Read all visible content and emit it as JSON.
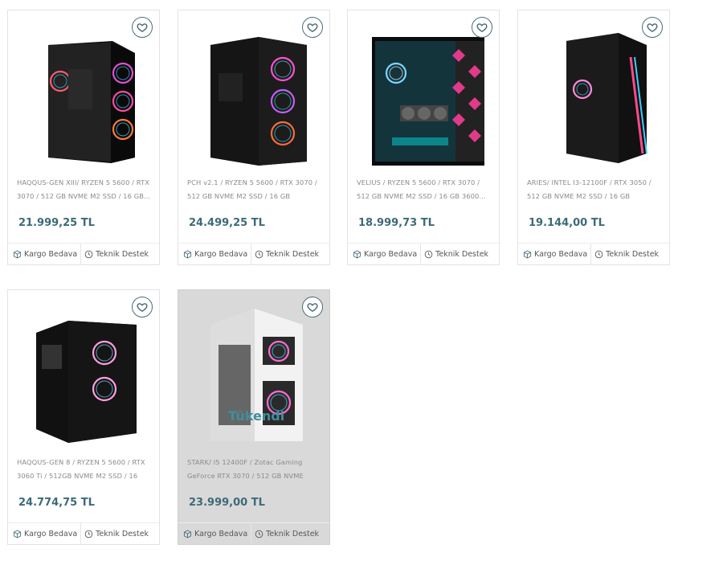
{
  "products": [
    {
      "title": "HAQQUS-GEN XIII/ RYZEN 5 5600 / RTX 3070 / 512 GB NVME M2 SSD / 16 GB...",
      "price": "21.999,25 TL",
      "badge1": "Kargo Bedava",
      "badge2": "Teknik Destek"
    },
    {
      "title": "PCH v2.1 / RYZEN 5 5600 / RTX 3070 / 512 GB NVME M2 SSD / 16 GB 3200MH...",
      "price": "24.499,25 TL",
      "badge1": "Kargo Bedava",
      "badge2": "Teknik Destek"
    },
    {
      "title": "VELIUS / RYZEN 5 5600 / RTX 3070 / 512 GB NVME M2 SSD / 16 GB 3600...",
      "price": "18.999,73 TL",
      "badge1": "Kargo Bedava",
      "badge2": "Teknik Destek"
    },
    {
      "title": "ARIES/ INTEL I3-12100F / RTX 3050 / 512 GB NVME M2 SSD / 16 GB 3200MH...",
      "price": "19.144,00 TL",
      "badge1": "Kargo Bedava",
      "badge2": "Teknik Destek"
    },
    {
      "title": "HAQQUS-GEN 8 / RYZEN 5 5600 / RTX 3060 Ti / 512GB NVME M2 SSD / 16 GB...",
      "price": "24.774,75 TL",
      "badge1": "Kargo Bedava",
      "badge2": "Teknik Destek"
    },
    {
      "title": "STARK/ I5 12400F / Zotac Gaming GeForce RTX 3070 / 512 GB NVME M2...",
      "price": "23.999,00 TL",
      "badge1": "Kargo Bedava",
      "badge2": "Teknik Destek",
      "stock_label": "Tükendi"
    }
  ],
  "icons": {
    "favorite": "heart-icon",
    "shipping": "box-icon",
    "support": "clock-icon"
  },
  "colors": {
    "price": "#3d6a78",
    "accent": "#4a6e7a",
    "sold_out_bg": "#d9d9d9"
  }
}
